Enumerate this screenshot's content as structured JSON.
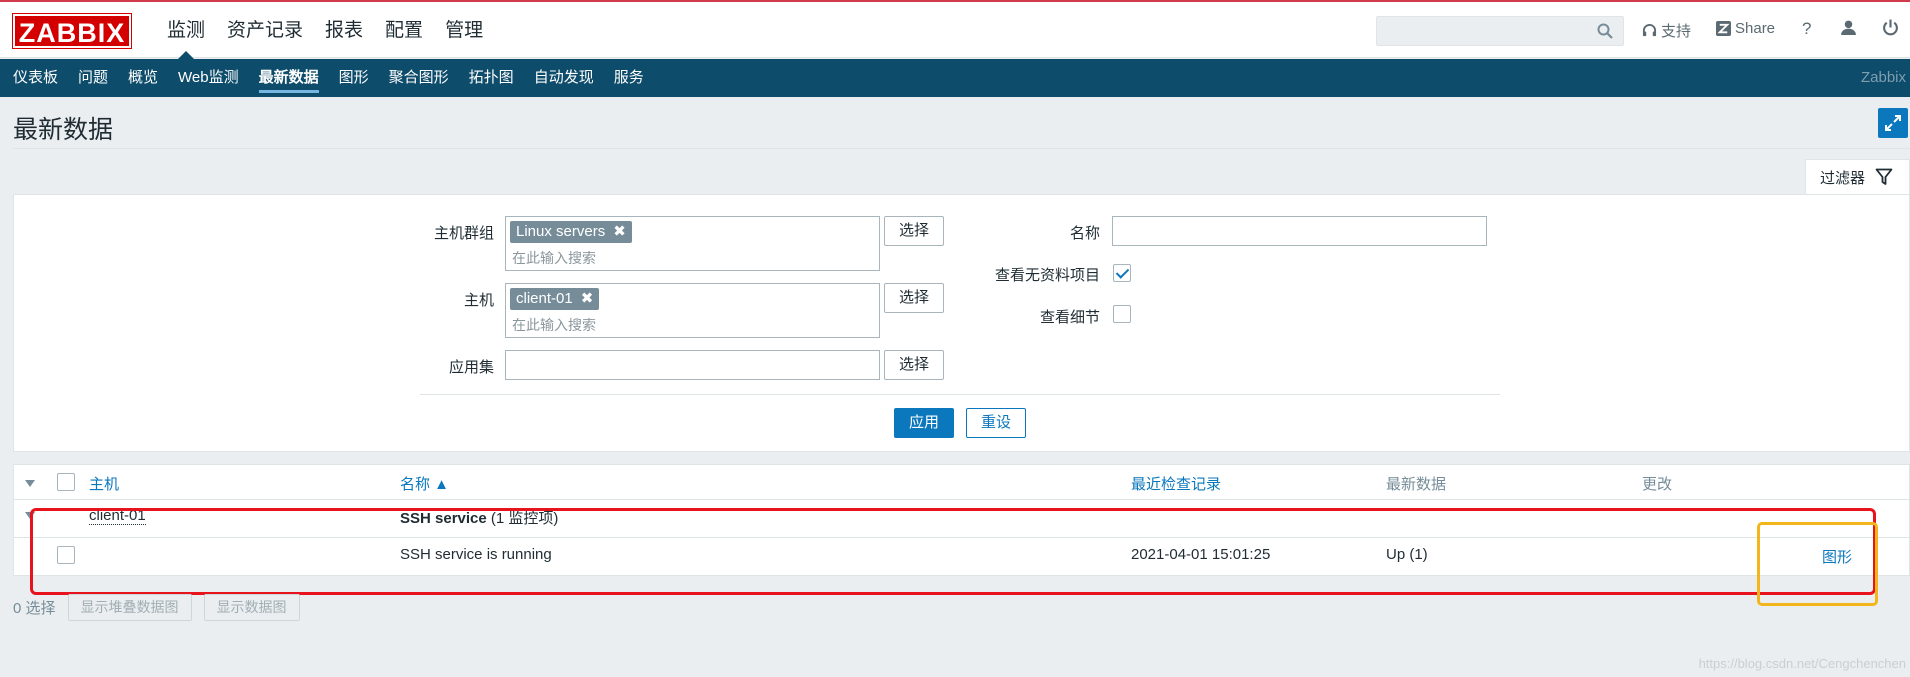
{
  "header": {
    "logo": "ZABBIX",
    "menu": [
      "监测",
      "资产记录",
      "报表",
      "配置",
      "管理"
    ],
    "search_placeholder": "",
    "support": "支持",
    "share": "Share",
    "help": "?",
    "brand_color": "#d40000"
  },
  "subnav": {
    "items": [
      "仪表板",
      "问题",
      "概览",
      "Web监测",
      "最新数据",
      "图形",
      "聚合图形",
      "拓扑图",
      "自动发现",
      "服务"
    ],
    "brand": "Zabbix"
  },
  "page": {
    "title": "最新数据"
  },
  "filter": {
    "tab_label": "过滤器",
    "host_group_label": "主机群组",
    "host_group_tag": "Linux servers",
    "host_label": "主机",
    "host_tag": "client-01",
    "search_placeholder": "在此输入搜索",
    "app_label": "应用集",
    "select_label": "选择",
    "name_label": "名称",
    "name_value": "",
    "show_no_data_label": "查看无资料项目",
    "show_no_data_checked": true,
    "show_details_label": "查看细节",
    "show_details_checked": false,
    "apply": "应用",
    "reset": "重设"
  },
  "table": {
    "columns": {
      "host": "主机",
      "name": "名称 ▲",
      "last_check": "最近检查记录",
      "last_value": "最新数据",
      "change": "更改"
    },
    "group_host": "client-01",
    "group_app": "SSH service",
    "group_count": "(1 监控项)",
    "rows": [
      {
        "name": "SSH service is running",
        "last_check": "2021-04-01 15:01:25",
        "last_value": "Up (1)",
        "action": "图形"
      }
    ]
  },
  "footer": {
    "selected": "0 选择",
    "stacked_graph": "显示堆叠数据图",
    "graph": "显示数据图"
  },
  "watermark": "https://blog.csdn.net/Cengchenchen"
}
